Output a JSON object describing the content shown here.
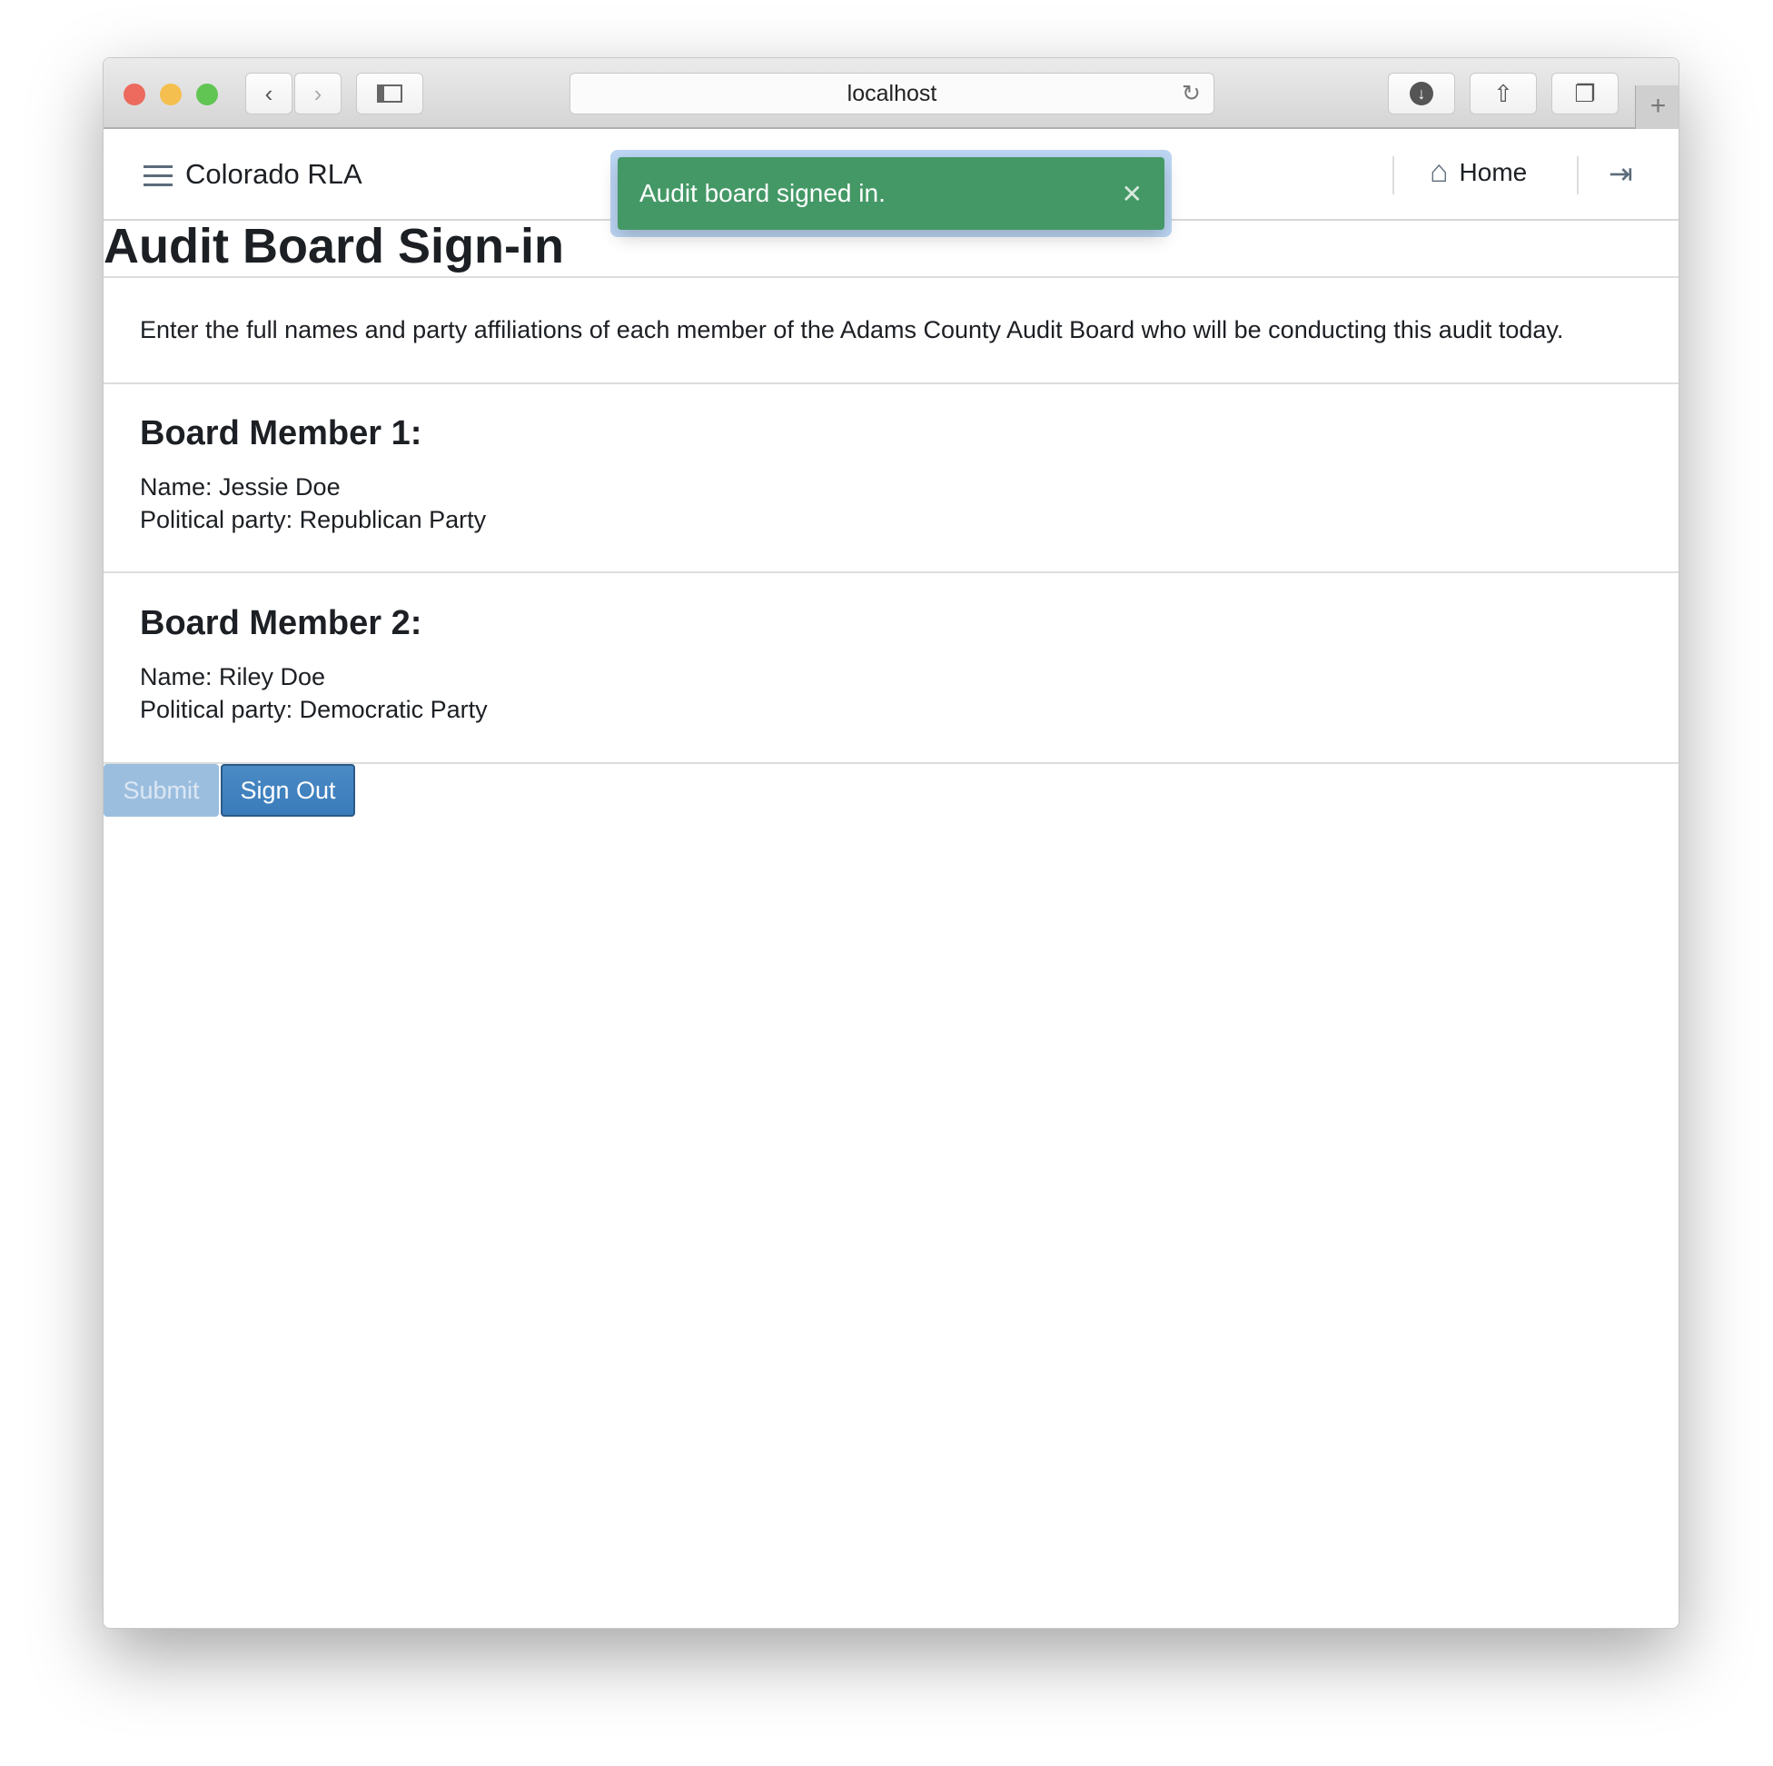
{
  "browser": {
    "url": "localhost"
  },
  "nav": {
    "brand": "Colorado RLA",
    "home": "Home"
  },
  "toast": {
    "message": "Audit board signed in.",
    "close": "✕"
  },
  "page": {
    "title": "Audit Board Sign-in",
    "description": "Enter the full names and party affiliations of each member of the Adams County Audit Board who will be conducting this audit today.",
    "members": [
      {
        "heading": "Board Member 1:",
        "name": "Name: Jessie Doe",
        "party": "Political party: Republican Party"
      },
      {
        "heading": "Board Member 2:",
        "name": "Name: Riley Doe",
        "party": "Political party: Democratic Party"
      }
    ],
    "submit": "Submit",
    "sign_out": "Sign Out"
  }
}
